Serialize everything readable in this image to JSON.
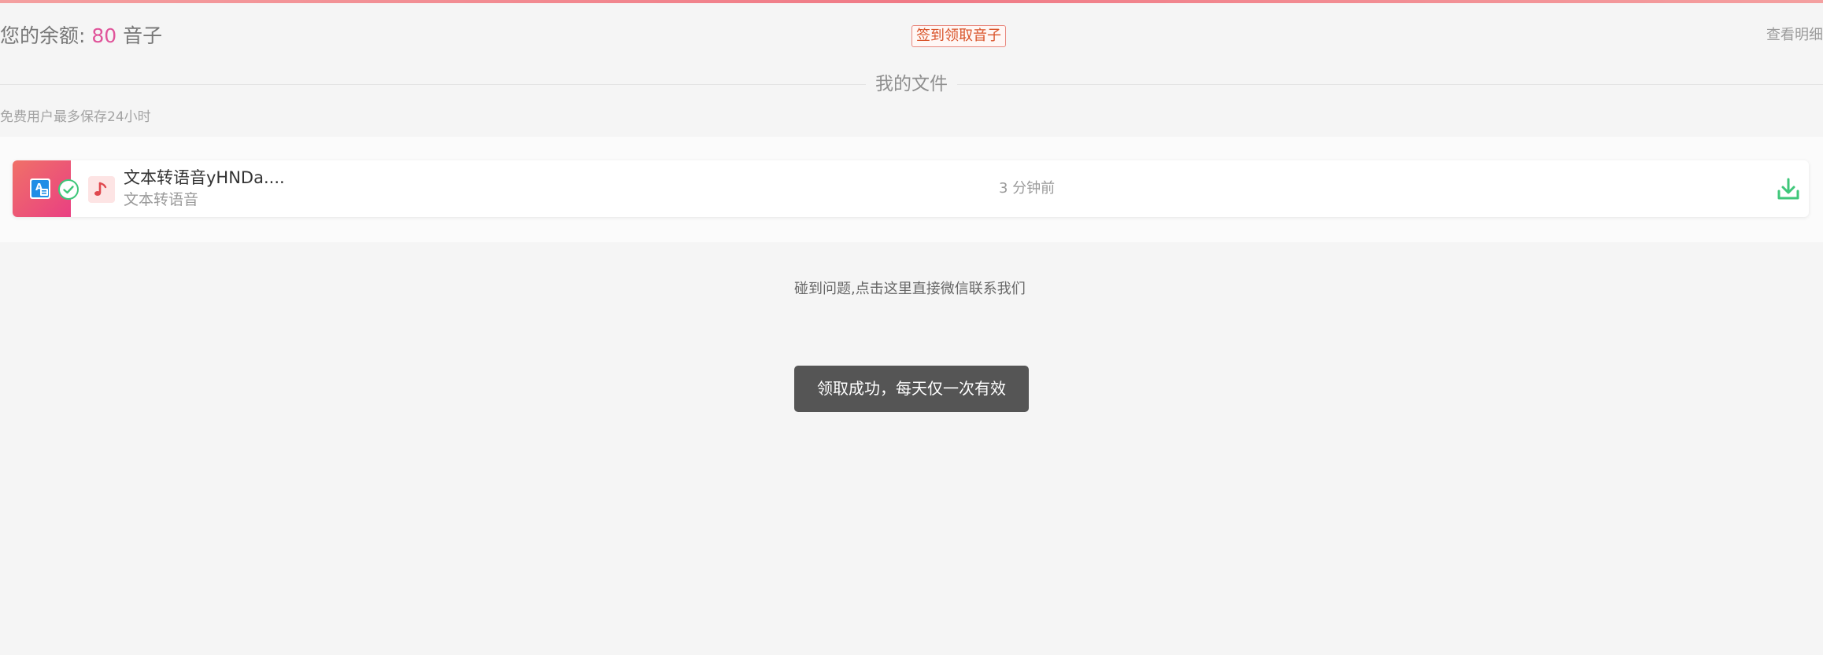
{
  "header": {
    "balance_label": "您的余额:",
    "balance_amount": "80",
    "balance_unit": "音子",
    "checkin_label": "签到领取音子",
    "details_label": "查看明细"
  },
  "files_section": {
    "title": "我的文件",
    "retention_note": "免费用户最多保存24小时",
    "files": [
      {
        "name": "文本转语音yHNDa....",
        "type": "文本转语音",
        "time": "3 分钟前",
        "status_icon": "check-circle-icon",
        "file_icon": "music-note-icon",
        "action_icon": "download-icon"
      }
    ]
  },
  "footer": {
    "contact_text": "碰到问题,点击这里直接微信联系我们"
  },
  "toast": {
    "message": "领取成功，每天仅一次有效"
  },
  "colors": {
    "accent_pink": "#e0549a",
    "checkin_red": "#d9542a",
    "download_green": "#3fc77a",
    "badge_gradient_start": "#f07168",
    "badge_gradient_end": "#e93f82",
    "toast_bg": "#555555"
  }
}
